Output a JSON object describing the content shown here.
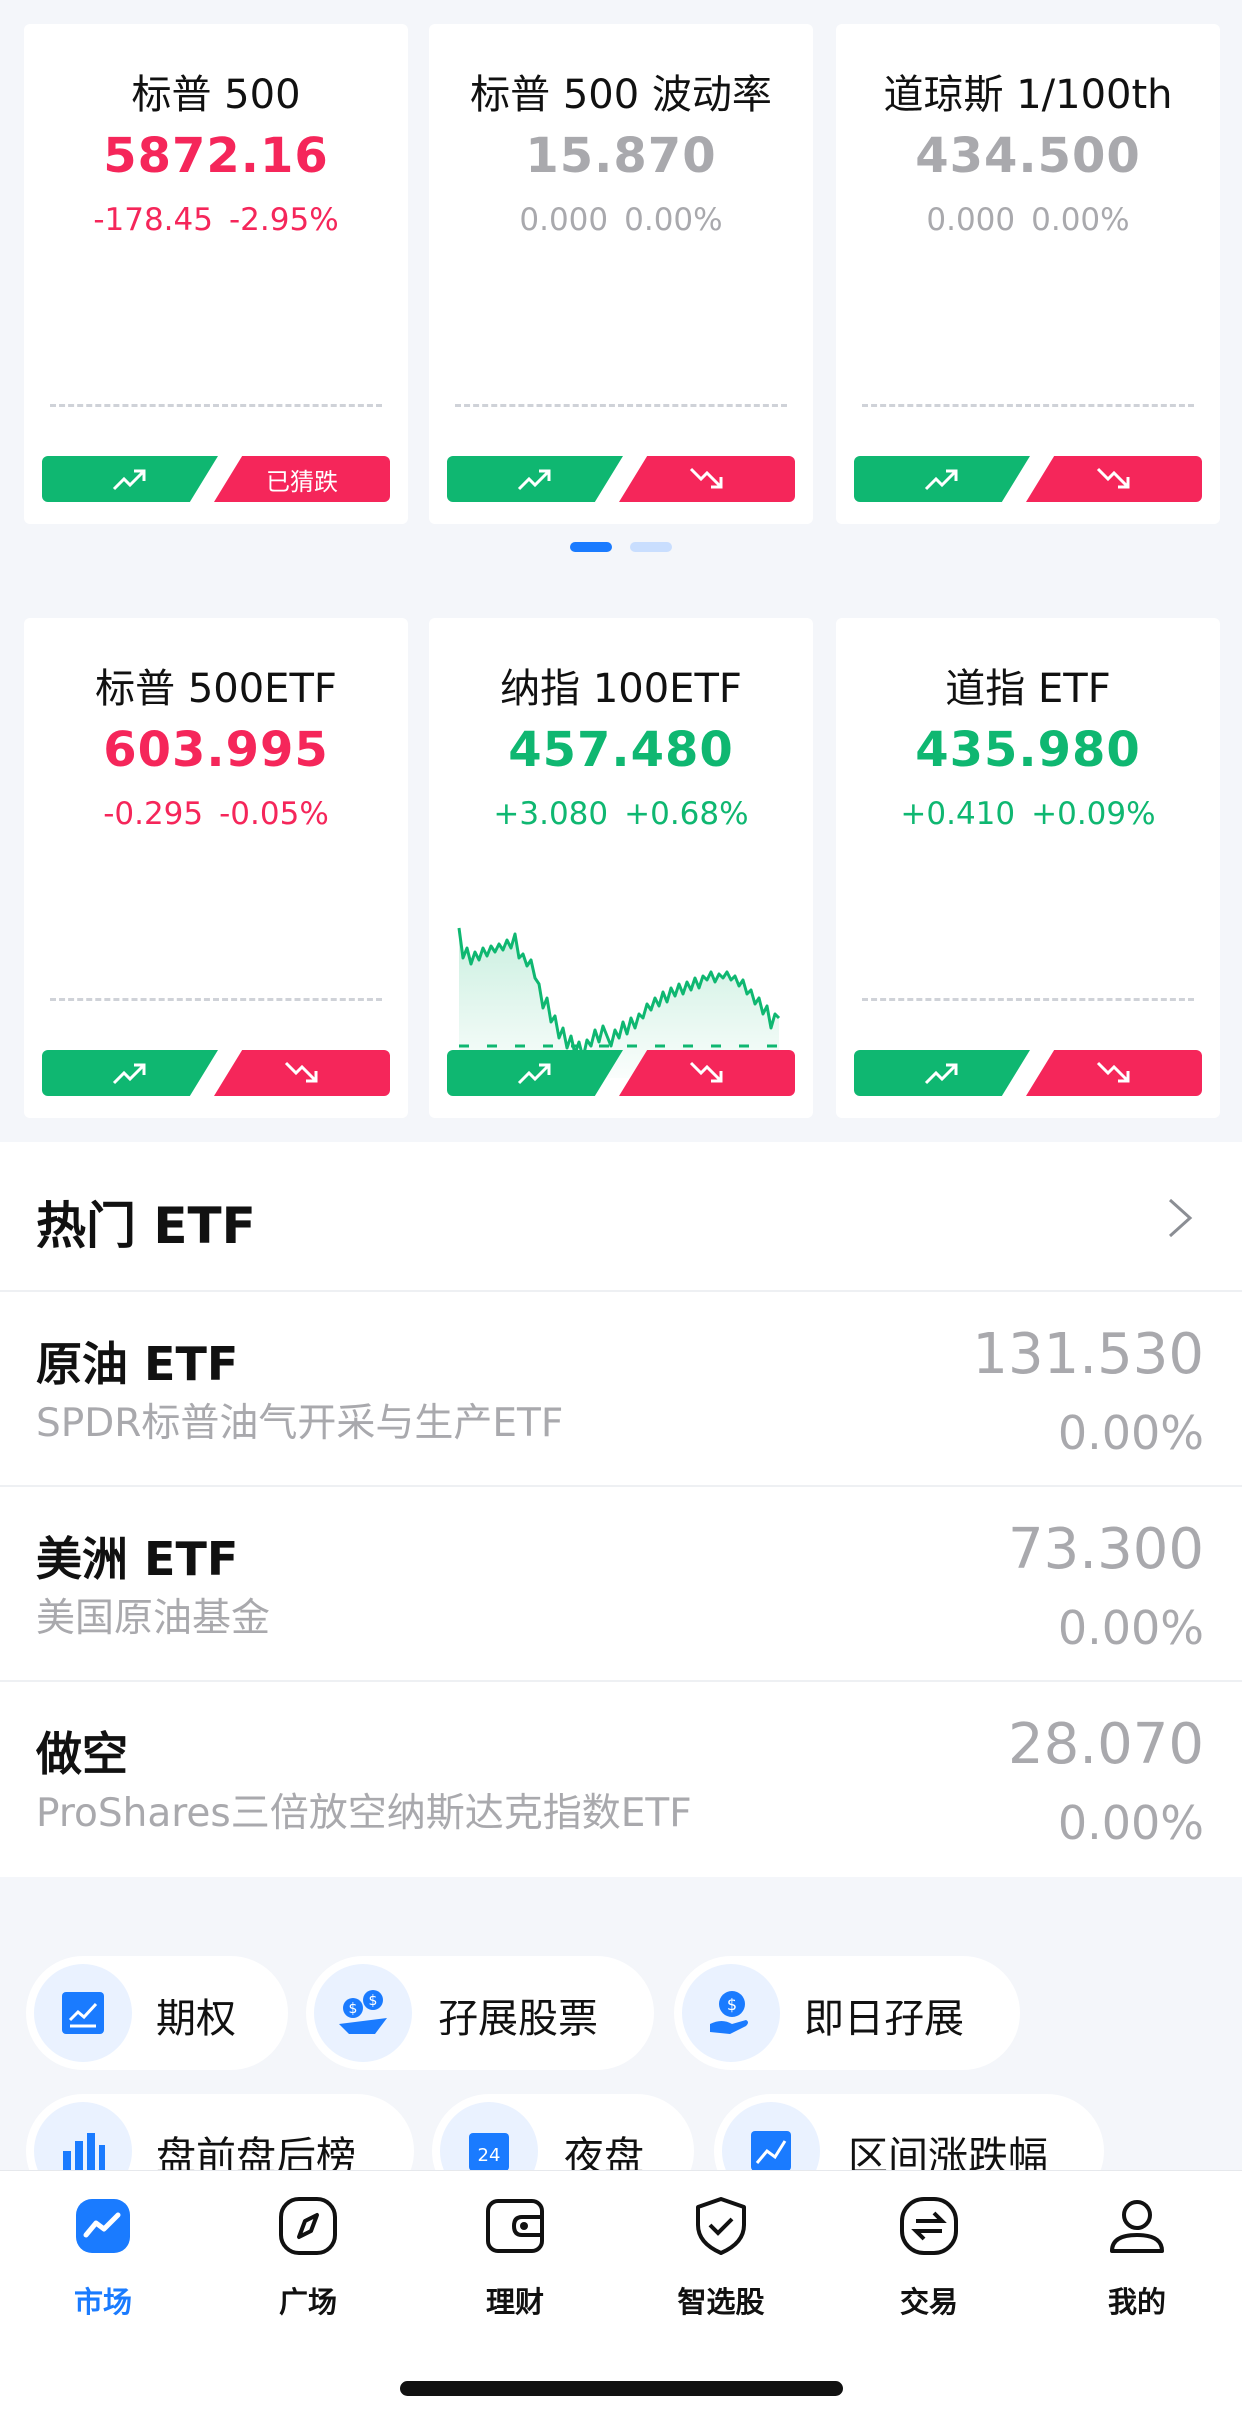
{
  "index_cards": [
    {
      "name": "标普 500",
      "price": "5872.16",
      "change": "-178.45",
      "pct": "-2.95%",
      "trend": "down",
      "up_label": "",
      "down_label": "已猜跌"
    },
    {
      "name": "标普 500 波动率",
      "price": "15.870",
      "change": "0.000",
      "pct": "0.00%",
      "trend": "flat",
      "up_label": "",
      "down_label": ""
    },
    {
      "name": "道琼斯 1/100th",
      "price": "434.500",
      "change": "0.000",
      "pct": "0.00%",
      "trend": "flat",
      "up_label": "",
      "down_label": ""
    }
  ],
  "etf_cards": [
    {
      "name": "标普 500ETF",
      "price": "603.995",
      "change": "-0.295",
      "pct": "-0.05%",
      "trend": "down"
    },
    {
      "name": "纳指 100ETF",
      "price": "457.480",
      "change": "+3.080",
      "pct": "+0.68%",
      "trend": "up"
    },
    {
      "name": "道指 ETF",
      "price": "435.980",
      "change": "+0.410",
      "pct": "+0.09%",
      "trend": "up"
    }
  ],
  "pager": {
    "pages": 2,
    "active": 0
  },
  "hot_etf": {
    "title": "热门 ETF",
    "rows": [
      {
        "name": "原油 ETF",
        "sub": "SPDR标普油气开采与生产ETF",
        "price": "131.530",
        "pct": "0.00%"
      },
      {
        "name": "美洲 ETF",
        "sub": "美国原油基金",
        "price": "73.300",
        "pct": "0.00%"
      },
      {
        "name": "做空",
        "sub": "ProShares三倍放空纳斯达克指数ETF",
        "price": "28.070",
        "pct": "0.00%"
      }
    ]
  },
  "tools": [
    {
      "label": "期权",
      "icon": "chart-icon"
    },
    {
      "label": "孖展股票",
      "icon": "coins-icon"
    },
    {
      "label": "即日孖展",
      "icon": "hand-dollar-icon"
    },
    {
      "label": "盘前盘后榜",
      "icon": "bar-chart-icon"
    },
    {
      "label": "夜盘",
      "icon": "calendar-24-icon",
      "badge": "24"
    },
    {
      "label": "区间涨跌幅",
      "icon": "trend-chart-icon"
    }
  ],
  "tabbar": [
    {
      "label": "市场",
      "icon": "market-icon",
      "active": true
    },
    {
      "label": "广场",
      "icon": "compass-icon",
      "active": false
    },
    {
      "label": "理财",
      "icon": "wallet-icon",
      "active": false
    },
    {
      "label": "智选股",
      "icon": "shield-check-icon",
      "active": false
    },
    {
      "label": "交易",
      "icon": "exchange-icon",
      "active": false
    },
    {
      "label": "我的",
      "icon": "user-icon",
      "active": false
    }
  ],
  "colors": {
    "up": "#0fb771",
    "down": "#f5265a",
    "flat": "#a9a9ad",
    "accent": "#1a7bff"
  }
}
